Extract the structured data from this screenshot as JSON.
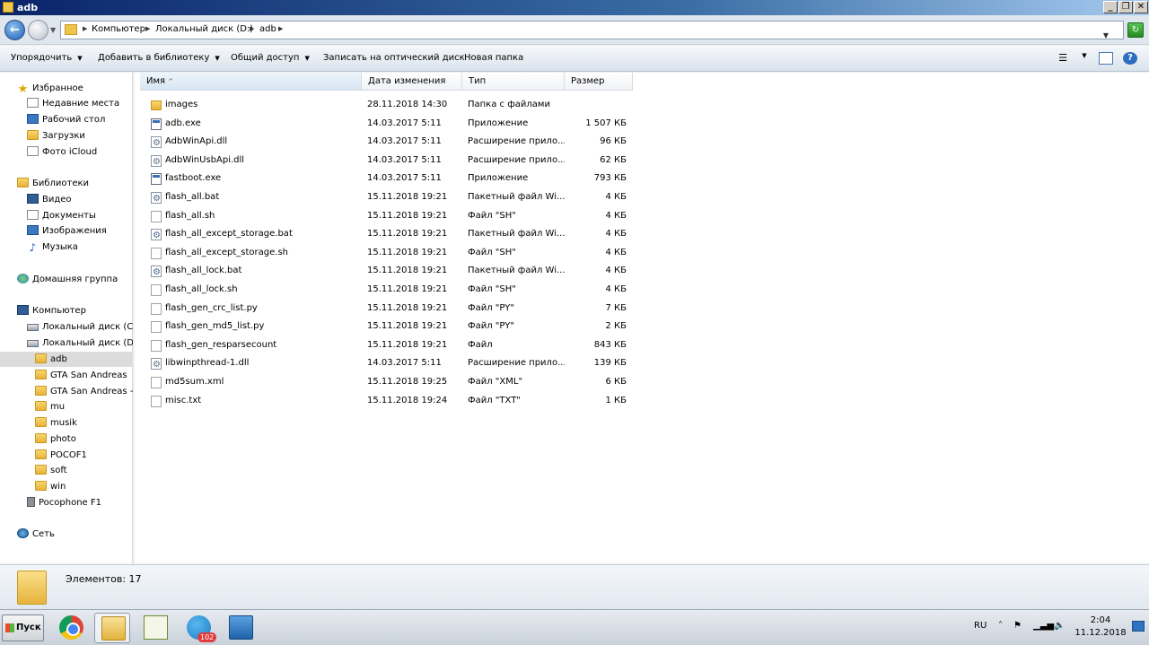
{
  "window": {
    "title": "adb"
  },
  "address": {
    "crumbs": [
      "Компьютер",
      "Локальный диск (D:)",
      "adb"
    ]
  },
  "toolbar": {
    "organize": "Упорядочить",
    "add_library": "Добавить в библиотеку",
    "share": "Общий доступ",
    "burn": "Записать на оптический диск",
    "new_folder": "Новая папка"
  },
  "nav": {
    "favorites": "Избранное",
    "recent": "Недавние места",
    "desktop": "Рабочий стол",
    "downloads": "Загрузки",
    "icloud": "Фото iCloud",
    "libraries": "Библиотеки",
    "video": "Видео",
    "documents": "Документы",
    "images": "Изображения",
    "music": "Музыка",
    "homegroup": "Домашняя группа",
    "computer": "Компьютер",
    "disk_c": "Локальный диск (C:)",
    "disk_d": "Локальный диск (D:)",
    "adb": "adb",
    "gta1": "GTA San Andreas",
    "gta2": "GTA San Andreas - к",
    "mu": "mu",
    "musik": "musik",
    "photo": "photo",
    "pocof1": "POCOF1",
    "soft": "soft",
    "win": "win",
    "pocophone": "Pocophone F1",
    "network": "Сеть"
  },
  "columns": {
    "name": "Имя",
    "date": "Дата изменения",
    "type": "Тип",
    "size": "Размер"
  },
  "files": [
    {
      "name": "images",
      "date": "28.11.2018 14:30",
      "type": "Папка с файлами",
      "size": "",
      "icon": "folder-icon"
    },
    {
      "name": "adb.exe",
      "date": "14.03.2017 5:11",
      "type": "Приложение",
      "size": "1 507 КБ",
      "icon": "exe-icon"
    },
    {
      "name": "AdbWinApi.dll",
      "date": "14.03.2017 5:11",
      "type": "Расширение прило...",
      "size": "96 КБ",
      "icon": "dll-icon"
    },
    {
      "name": "AdbWinUsbApi.dll",
      "date": "14.03.2017 5:11",
      "type": "Расширение прило...",
      "size": "62 КБ",
      "icon": "dll-icon"
    },
    {
      "name": "fastboot.exe",
      "date": "14.03.2017 5:11",
      "type": "Приложение",
      "size": "793 КБ",
      "icon": "exe-icon"
    },
    {
      "name": "flash_all.bat",
      "date": "15.11.2018 19:21",
      "type": "Пакетный файл Wi...",
      "size": "4 КБ",
      "icon": "bat-icon"
    },
    {
      "name": "flash_all.sh",
      "date": "15.11.2018 19:21",
      "type": "Файл \"SH\"",
      "size": "4 КБ",
      "icon": "file-icon"
    },
    {
      "name": "flash_all_except_storage.bat",
      "date": "15.11.2018 19:21",
      "type": "Пакетный файл Wi...",
      "size": "4 КБ",
      "icon": "bat-icon"
    },
    {
      "name": "flash_all_except_storage.sh",
      "date": "15.11.2018 19:21",
      "type": "Файл \"SH\"",
      "size": "4 КБ",
      "icon": "file-icon"
    },
    {
      "name": "flash_all_lock.bat",
      "date": "15.11.2018 19:21",
      "type": "Пакетный файл Wi...",
      "size": "4 КБ",
      "icon": "bat-icon"
    },
    {
      "name": "flash_all_lock.sh",
      "date": "15.11.2018 19:21",
      "type": "Файл \"SH\"",
      "size": "4 КБ",
      "icon": "file-icon"
    },
    {
      "name": "flash_gen_crc_list.py",
      "date": "15.11.2018 19:21",
      "type": "Файл \"PY\"",
      "size": "7 КБ",
      "icon": "file-icon"
    },
    {
      "name": "flash_gen_md5_list.py",
      "date": "15.11.2018 19:21",
      "type": "Файл \"PY\"",
      "size": "2 КБ",
      "icon": "file-icon"
    },
    {
      "name": "flash_gen_resparsecount",
      "date": "15.11.2018 19:21",
      "type": "Файл",
      "size": "843 КБ",
      "icon": "file-icon"
    },
    {
      "name": "libwinpthread-1.dll",
      "date": "14.03.2017 5:11",
      "type": "Расширение прило...",
      "size": "139 КБ",
      "icon": "dll-icon"
    },
    {
      "name": "md5sum.xml",
      "date": "15.11.2018 19:25",
      "type": "Файл \"XML\"",
      "size": "6 КБ",
      "icon": "file-icon"
    },
    {
      "name": "misc.txt",
      "date": "15.11.2018 19:24",
      "type": "Файл \"TXT\"",
      "size": "1 КБ",
      "icon": "file-icon"
    }
  ],
  "details": {
    "count": "Элементов: 17"
  },
  "taskbar": {
    "start": "Пуск",
    "telegram_badge": "102",
    "lang": "RU",
    "time": "2:04",
    "date": "11.12.2018"
  }
}
